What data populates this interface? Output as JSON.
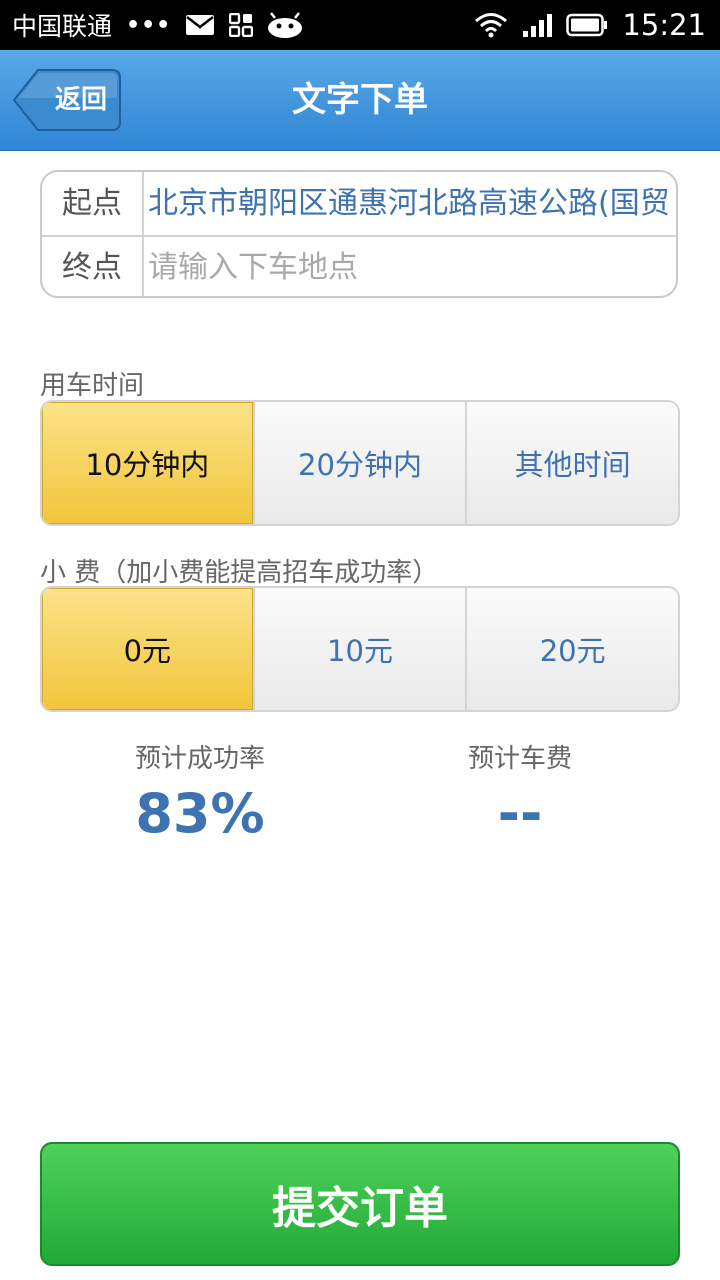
{
  "status_bar": {
    "carrier": "中国联通",
    "dots": "•••",
    "time": "15:21",
    "icons": [
      "mail-icon",
      "grid-icon",
      "android-icon",
      "wifi-icon",
      "signal-icon",
      "battery-icon"
    ]
  },
  "header": {
    "back_label": "返回",
    "title": "文字下单",
    "color": "#3b8fd8"
  },
  "address": {
    "start_label": "起点",
    "start_value": "北京市朝阳区通惠河北路高速公路(国贸",
    "end_label": "终点",
    "end_placeholder": "请输入下车地点"
  },
  "time_section": {
    "label": "用车时间",
    "options": [
      "10分钟内",
      "20分钟内",
      "其他时间"
    ],
    "selected": "10分钟内"
  },
  "tip_section": {
    "label": "小 费（加小费能提高招车成功率）",
    "options": [
      "0元",
      "10元",
      "20元"
    ],
    "selected": "0元"
  },
  "estimates": {
    "success_label": "预计成功率",
    "success_value": "83%",
    "fare_label": "预计车费",
    "fare_value": "--"
  },
  "submit": {
    "label": "提交订单",
    "color": "#2fb844"
  },
  "colors": {
    "accent_blue": "#3f72b0",
    "selected_yellow": "#f5cf4f"
  }
}
